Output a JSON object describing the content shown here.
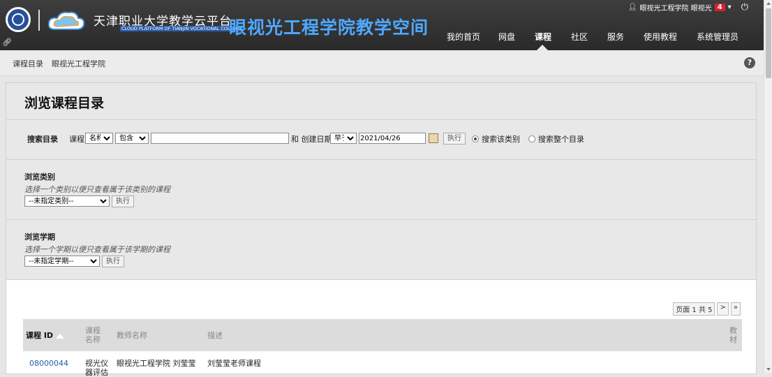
{
  "header": {
    "cn_title": "天津职业大学教学云平台",
    "en_title": "CLOUD PLATFORM OF TIANJIN VOCATIONAL COLLEGE",
    "space_title": "眼视光工程学院教学空间",
    "nav": [
      "我的首页",
      "网盘",
      "课程",
      "社区",
      "服务",
      "使用教程",
      "系统管理员"
    ],
    "user": "眼视光工程学院 眼视光",
    "badge": "4"
  },
  "breadcrumb": [
    "课程目录",
    "眼视光工程学院"
  ],
  "page": {
    "title": "浏览课程目录",
    "search": {
      "label": "搜索目录",
      "field_label": "课程",
      "field_value": "名称",
      "op_value": "包含",
      "query": "",
      "and_created": "和 创建日期",
      "date_op": "早于",
      "date": "2021/04/26",
      "go": "执行",
      "radio1": "搜索该类别",
      "radio2": "搜索整个目录"
    },
    "category": {
      "title": "浏览类别",
      "desc": "选择一个类别以便只查看属于该类别的课程",
      "value": "--未指定类别--",
      "go": "执行"
    },
    "term": {
      "title": "浏览学期",
      "desc": "选择一个学期以便只查看属于该学期的课程",
      "value": "--未指定学期--",
      "go": "执行"
    },
    "pager": {
      "text": "页面 1 共 5",
      "next": ">",
      "last": "»"
    },
    "table": {
      "headers": [
        "课程 ID",
        "课程名称",
        "教师名称",
        "描述",
        "教材"
      ],
      "rows": [
        {
          "id": "08000044",
          "name": "视光仪器评估",
          "teacher": "眼视光工程学院 刘莹莹",
          "desc": "刘莹莹老师课程"
        }
      ]
    }
  }
}
